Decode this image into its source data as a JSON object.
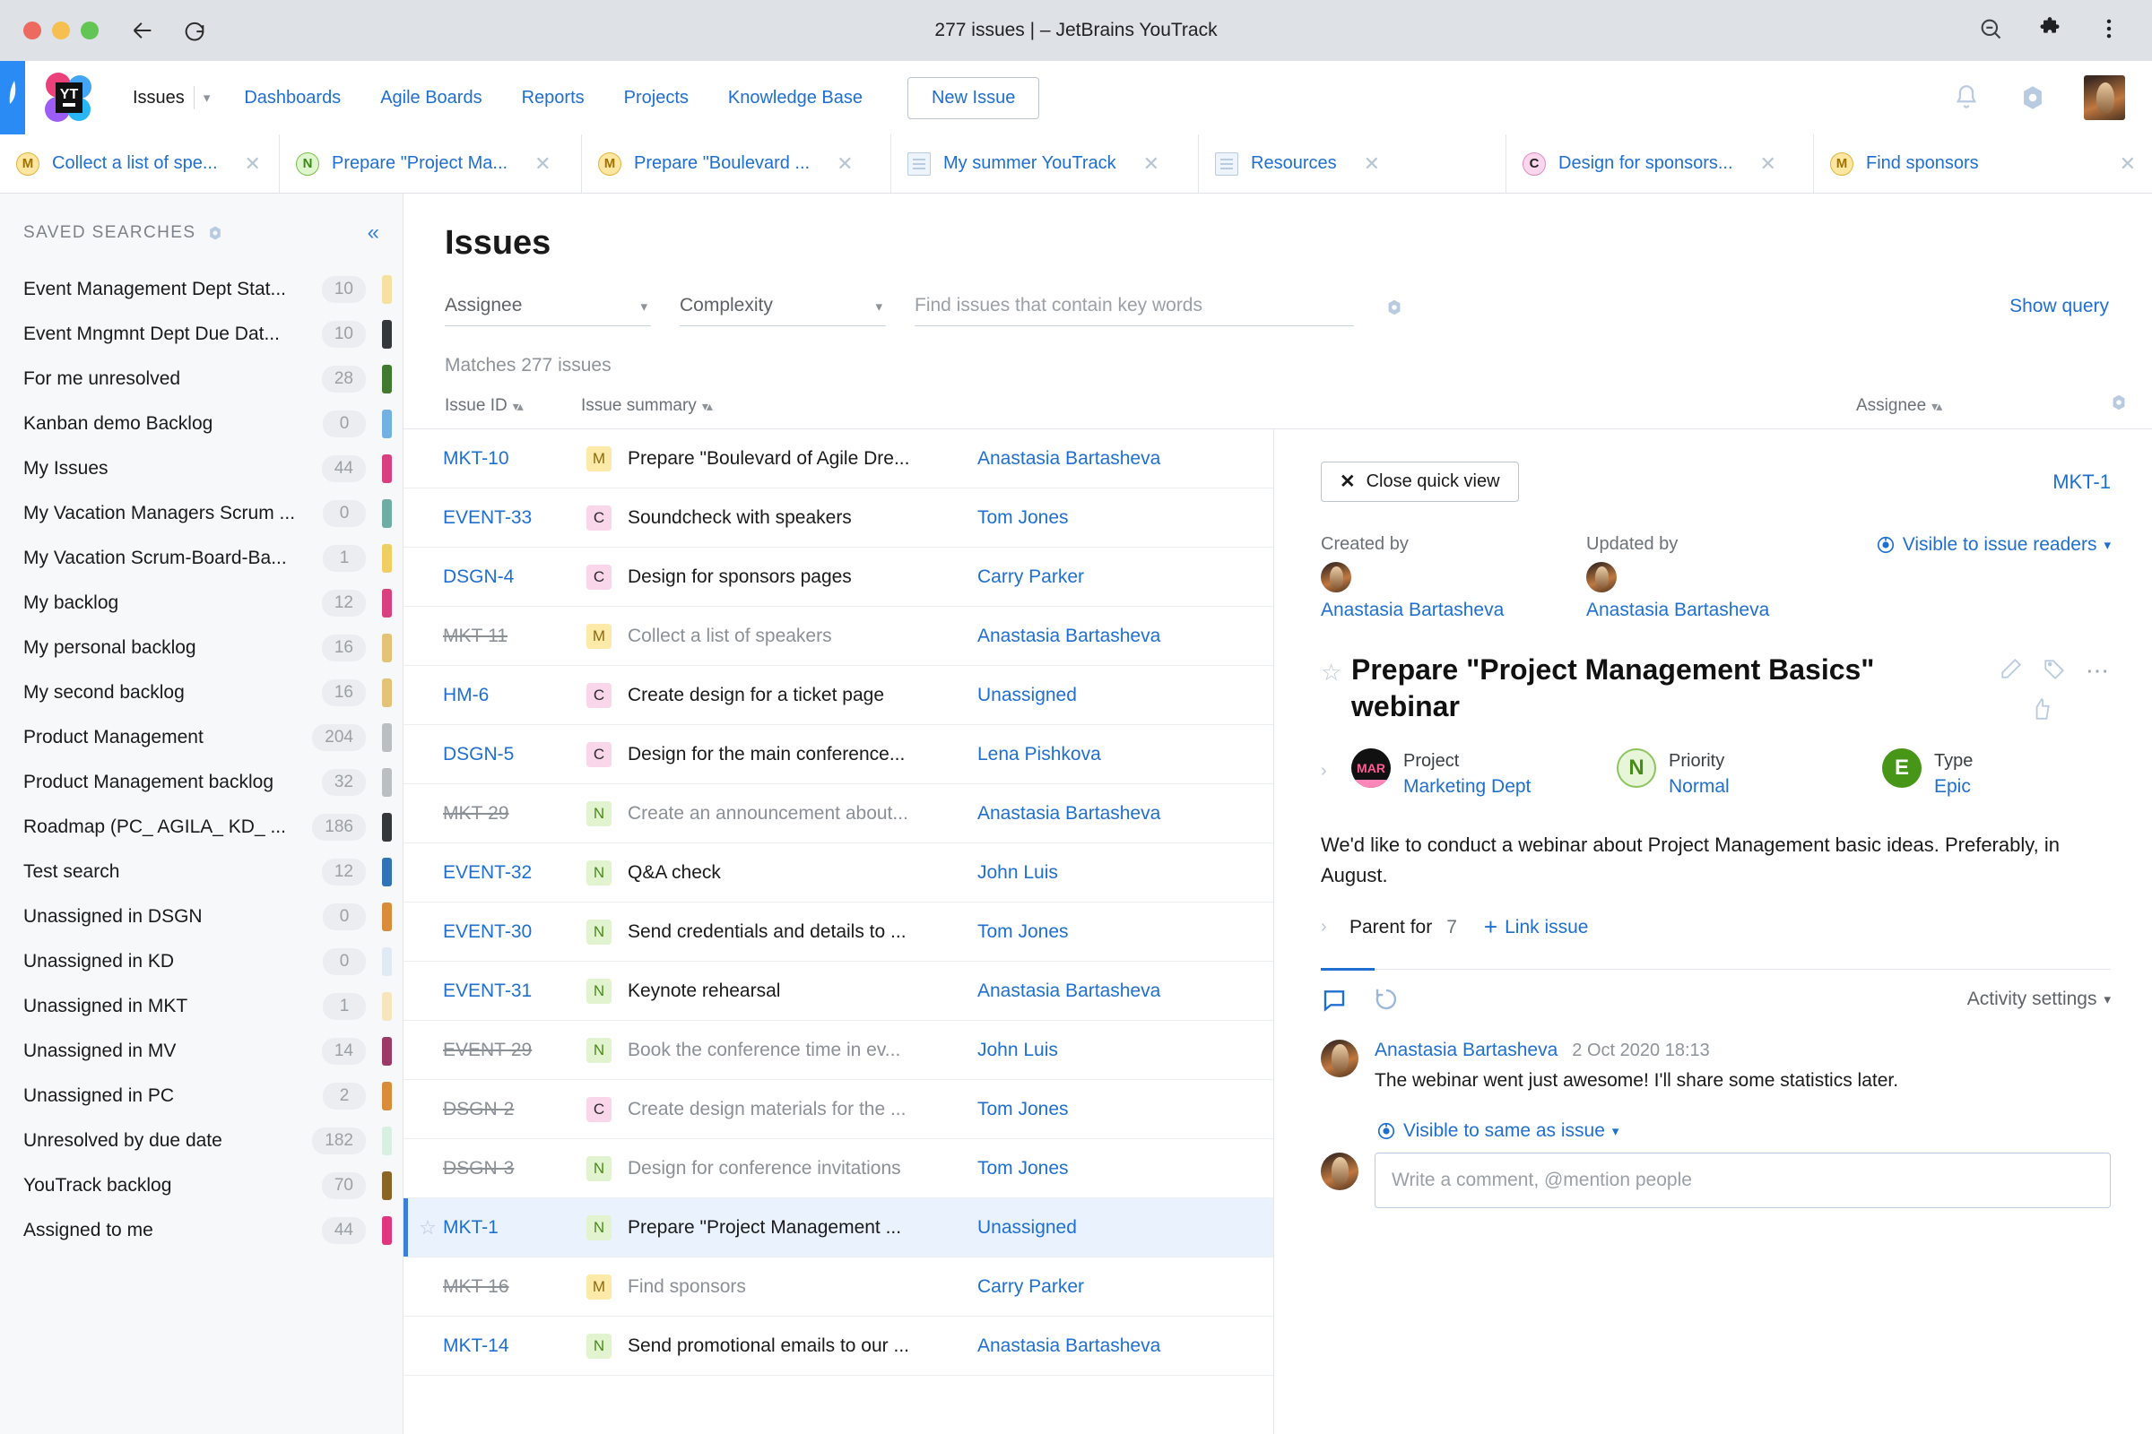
{
  "browser": {
    "title": "277 issues | – JetBrains YouTrack",
    "back_icon": "back-arrow-icon",
    "reload_icon": "reload-icon",
    "zoom_out_icon": "zoom-out-icon",
    "extensions_icon": "extensions-puzzle-icon",
    "menu_icon": "browser-menu-icon"
  },
  "header": {
    "logo": "youtrack-logo",
    "menu": [
      {
        "label": "Issues",
        "active": true
      },
      {
        "label": "Dashboards",
        "active": false
      },
      {
        "label": "Agile Boards",
        "active": false
      },
      {
        "label": "Reports",
        "active": false
      },
      {
        "label": "Projects",
        "active": false
      },
      {
        "label": "Knowledge Base",
        "active": false
      }
    ],
    "new_issue_label": "New Issue",
    "bell_icon": "notifications-bell-icon",
    "gear_icon": "settings-gear-icon",
    "avatar": "user-avatar"
  },
  "tabs": [
    {
      "label": "Collect a list of spe...",
      "icon": "M",
      "kind": "m"
    },
    {
      "label": "Prepare \"Project Ma...",
      "icon": "N",
      "kind": "n"
    },
    {
      "label": "Prepare \"Boulevard ...",
      "icon": "M",
      "kind": "m"
    },
    {
      "label": "My summer YouTrack",
      "icon": "",
      "kind": "doc"
    },
    {
      "label": "Resources",
      "icon": "",
      "kind": "doc"
    },
    {
      "label": "Design for sponsors...",
      "icon": "C",
      "kind": "c"
    },
    {
      "label": "Find sponsors",
      "icon": "M",
      "kind": "m"
    }
  ],
  "sidebar": {
    "title": "SAVED SEARCHES",
    "gear_icon": "saved-searches-settings-icon",
    "collapse_icon": "collapse-sidebar-icon",
    "items": [
      {
        "label": "Event Management Dept Stat...",
        "count": "10",
        "color": "#f6e2a0"
      },
      {
        "label": "Event Mngmnt Dept Due Dat...",
        "count": "10",
        "color": "#34383c"
      },
      {
        "label": "For me unresolved",
        "count": "28",
        "color": "#3f7a2e"
      },
      {
        "label": "Kanban demo Backlog",
        "count": "0",
        "color": "#71b2e3"
      },
      {
        "label": "My Issues",
        "count": "44",
        "color": "#d8407f"
      },
      {
        "label": "My Vacation Managers Scrum ...",
        "count": "0",
        "color": "#6eada6"
      },
      {
        "label": "My Vacation Scrum-Board-Ba...",
        "count": "1",
        "color": "#f0cf62"
      },
      {
        "label": "My backlog",
        "count": "12",
        "color": "#d8407f"
      },
      {
        "label": "My personal backlog",
        "count": "16",
        "color": "#e3c476"
      },
      {
        "label": "My second backlog",
        "count": "16",
        "color": "#e3c476"
      },
      {
        "label": "Product Management",
        "count": "204",
        "color": "#bcbfc2"
      },
      {
        "label": "Product Management backlog",
        "count": "32",
        "color": "#bcbfc2"
      },
      {
        "label": "Roadmap (PC_ AGILA_ KD_ ...",
        "count": "186",
        "color": "#34383c"
      },
      {
        "label": "Test search",
        "count": "12",
        "color": "#3173b8"
      },
      {
        "label": "Unassigned in DSGN",
        "count": "0",
        "color": "#d98c3a"
      },
      {
        "label": "Unassigned in KD",
        "count": "0",
        "color": "#dfeaf5"
      },
      {
        "label": "Unassigned in MKT",
        "count": "1",
        "color": "#f7e5bd"
      },
      {
        "label": "Unassigned in MV",
        "count": "14",
        "color": "#9b3a66"
      },
      {
        "label": "Unassigned in PC",
        "count": "2",
        "color": "#d98c3a"
      },
      {
        "label": "Unresolved by due date",
        "count": "182",
        "color": "#d8f0e2"
      },
      {
        "label": "YouTrack backlog",
        "count": "70",
        "color": "#8a6524"
      },
      {
        "label": "Assigned to me",
        "count": "44",
        "color": "#e0357f"
      }
    ]
  },
  "content": {
    "page_title": "Issues",
    "filters": [
      {
        "label": "Assignee",
        "name": "assignee-filter"
      },
      {
        "label": "Complexity",
        "name": "complexity-filter"
      }
    ],
    "search_placeholder": "Find issues that contain key words",
    "search_value": "",
    "search_gear_icon": "search-settings-icon",
    "show_query_label": "Show query",
    "matches_label": "Matches 277 issues",
    "columns": [
      {
        "label": "Issue ID"
      },
      {
        "label": "Issue summary"
      },
      {
        "label": "Assignee"
      }
    ],
    "table_gear_icon": "table-settings-icon",
    "rows": [
      {
        "id": "MKT-10",
        "type": "M",
        "summary": "Prepare \"Boulevard of Agile Dre...",
        "assignee": "Anastasia Bartasheva",
        "resolved": false,
        "selected": false,
        "starred": false
      },
      {
        "id": "EVENT-33",
        "type": "C",
        "summary": "Soundcheck with speakers",
        "assignee": "Tom Jones",
        "resolved": false,
        "selected": false,
        "starred": false
      },
      {
        "id": "DSGN-4",
        "type": "C",
        "summary": "Design for sponsors pages",
        "assignee": "Carry Parker",
        "resolved": false,
        "selected": false,
        "starred": false
      },
      {
        "id": "MKT-11",
        "type": "M",
        "summary": "Collect a list of speakers",
        "assignee": "Anastasia Bartasheva",
        "resolved": true,
        "selected": false,
        "starred": false
      },
      {
        "id": "HM-6",
        "type": "C",
        "summary": "Create design for a ticket page",
        "assignee": "Unassigned",
        "resolved": false,
        "selected": false,
        "starred": false
      },
      {
        "id": "DSGN-5",
        "type": "C",
        "summary": "Design for the main conference...",
        "assignee": "Lena Pishkova",
        "resolved": false,
        "selected": false,
        "starred": false
      },
      {
        "id": "MKT-29",
        "type": "N",
        "summary": "Create an announcement about...",
        "assignee": "Anastasia Bartasheva",
        "resolved": true,
        "selected": false,
        "starred": false
      },
      {
        "id": "EVENT-32",
        "type": "N",
        "summary": "Q&A check",
        "assignee": "John Luis",
        "resolved": false,
        "selected": false,
        "starred": false
      },
      {
        "id": "EVENT-30",
        "type": "N",
        "summary": "Send credentials and details to ...",
        "assignee": "Tom Jones",
        "resolved": false,
        "selected": false,
        "starred": false
      },
      {
        "id": "EVENT-31",
        "type": "N",
        "summary": "Keynote rehearsal",
        "assignee": "Anastasia Bartasheva",
        "resolved": false,
        "selected": false,
        "starred": false
      },
      {
        "id": "EVENT-29",
        "type": "N",
        "summary": "Book the conference time in ev...",
        "assignee": "John Luis",
        "resolved": true,
        "selected": false,
        "starred": false
      },
      {
        "id": "DSGN-2",
        "type": "C",
        "summary": "Create design materials for the ...",
        "assignee": "Tom Jones",
        "resolved": true,
        "selected": false,
        "starred": false
      },
      {
        "id": "DSGN-3",
        "type": "N",
        "summary": "Design for conference invitations",
        "assignee": "Tom Jones",
        "resolved": true,
        "selected": false,
        "starred": false
      },
      {
        "id": "MKT-1",
        "type": "N",
        "summary": "Prepare \"Project Management ...",
        "assignee": "Unassigned",
        "resolved": false,
        "selected": true,
        "starred": true
      },
      {
        "id": "MKT-16",
        "type": "M",
        "summary": "Find sponsors",
        "assignee": "Carry Parker",
        "resolved": true,
        "selected": false,
        "starred": false
      },
      {
        "id": "MKT-14",
        "type": "N",
        "summary": "Send promotional emails to our ...",
        "assignee": "Anastasia Bartasheva",
        "resolved": false,
        "selected": false,
        "starred": false
      }
    ]
  },
  "quickview": {
    "close_label": "Close quick view",
    "issue_id": "MKT-1",
    "created_by_label": "Created by",
    "created_by_name": "Anastasia Bartasheva",
    "updated_by_label": "Updated by",
    "updated_by_name": "Anastasia Bartasheva",
    "visibility_label": "Visible to issue readers",
    "title": "Prepare \"Project Management Basics\" webinar",
    "edit_icon": "edit-pencil-icon",
    "tag_icon": "tag-icon",
    "more_icon": "more-options-icon",
    "vote_icon": "thumbs-up-icon",
    "fields": [
      {
        "name": "project",
        "label": "Project",
        "value": "Marketing Dept",
        "badge": "MAR"
      },
      {
        "name": "priority",
        "label": "Priority",
        "value": "Normal",
        "badge": "N"
      },
      {
        "name": "type",
        "label": "Type",
        "value": "Epic",
        "badge": "E"
      }
    ],
    "description": "We'd like to conduct a webinar about Project Management basic ideas. Preferably, in August.",
    "parent_for_label": "Parent for",
    "parent_for_count": "7",
    "link_issue_label": "Link issue",
    "activity_settings_label": "Activity settings",
    "comment_tab_icon": "comments-tab-icon",
    "history_tab_icon": "history-tab-icon",
    "comments": [
      {
        "author": "Anastasia Bartasheva",
        "time": "2 Oct 2020 18:13",
        "body": "The webinar went just awesome! I'll share some statistics later."
      }
    ],
    "comment_visibility_label": "Visible to same as issue",
    "comment_placeholder": "Write a comment, @mention people"
  }
}
